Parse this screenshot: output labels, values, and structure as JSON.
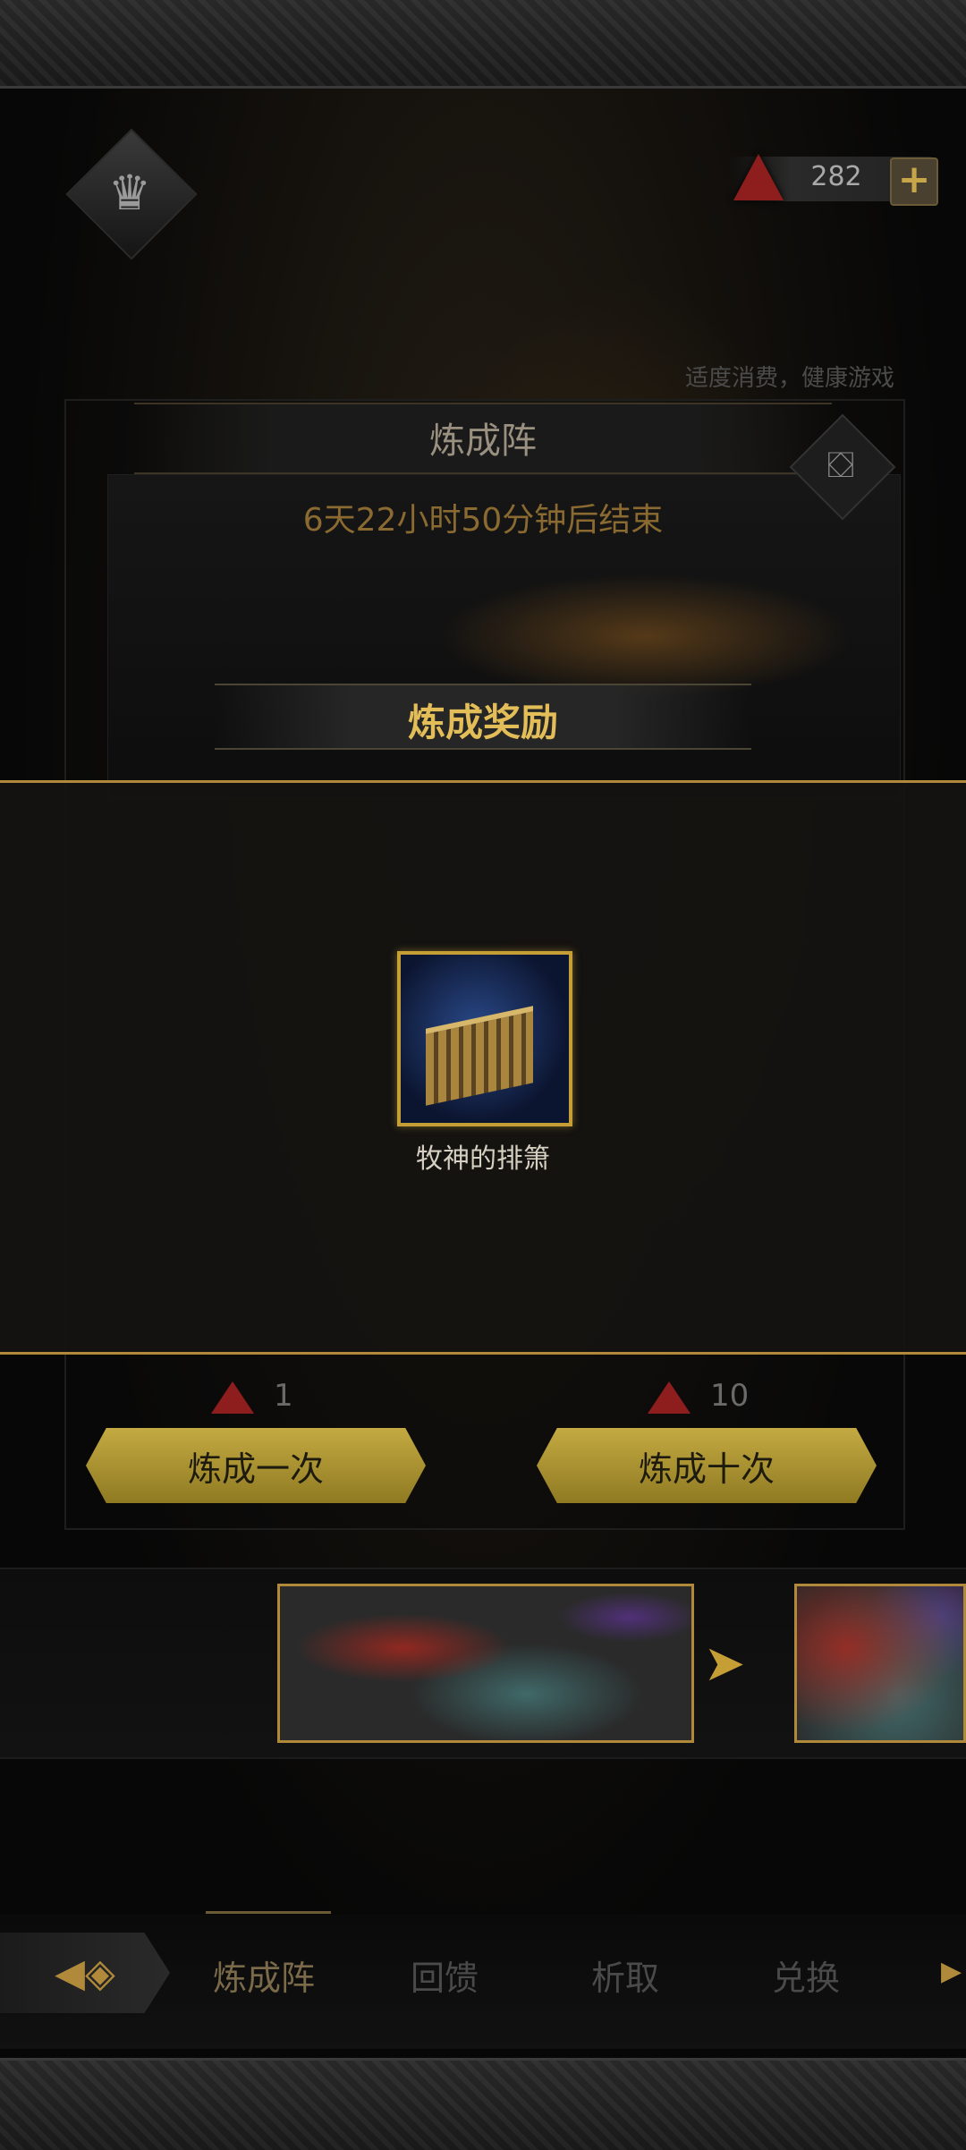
{
  "header": {
    "crown_icon": "crown-icon",
    "currency_value": "282",
    "plus_label": "+",
    "notice": "适度消费，健康游戏"
  },
  "panel": {
    "title": "炼成阵",
    "timer": "6天22小时50分钟后结束",
    "chest_icon": "chest-icon",
    "reward_title": "炼成奖励"
  },
  "reward": {
    "item_name": "牧神的排箫",
    "item_icon": "pan-flute-icon"
  },
  "forge": {
    "once": {
      "cost": "1",
      "label": "炼成一次"
    },
    "ten": {
      "cost": "10",
      "label": "炼成十次"
    }
  },
  "carousel": {
    "arrow": "➤"
  },
  "nav": {
    "back_glyph": "◀◈",
    "tabs": [
      {
        "label": "炼成阵",
        "active": true
      },
      {
        "label": "回馈",
        "active": false
      },
      {
        "label": "析取",
        "active": false
      },
      {
        "label": "兑换",
        "active": false
      }
    ],
    "more": "▶"
  },
  "colors": {
    "accent_gold": "#c59e35",
    "gem_red": "#8e1d1d"
  }
}
